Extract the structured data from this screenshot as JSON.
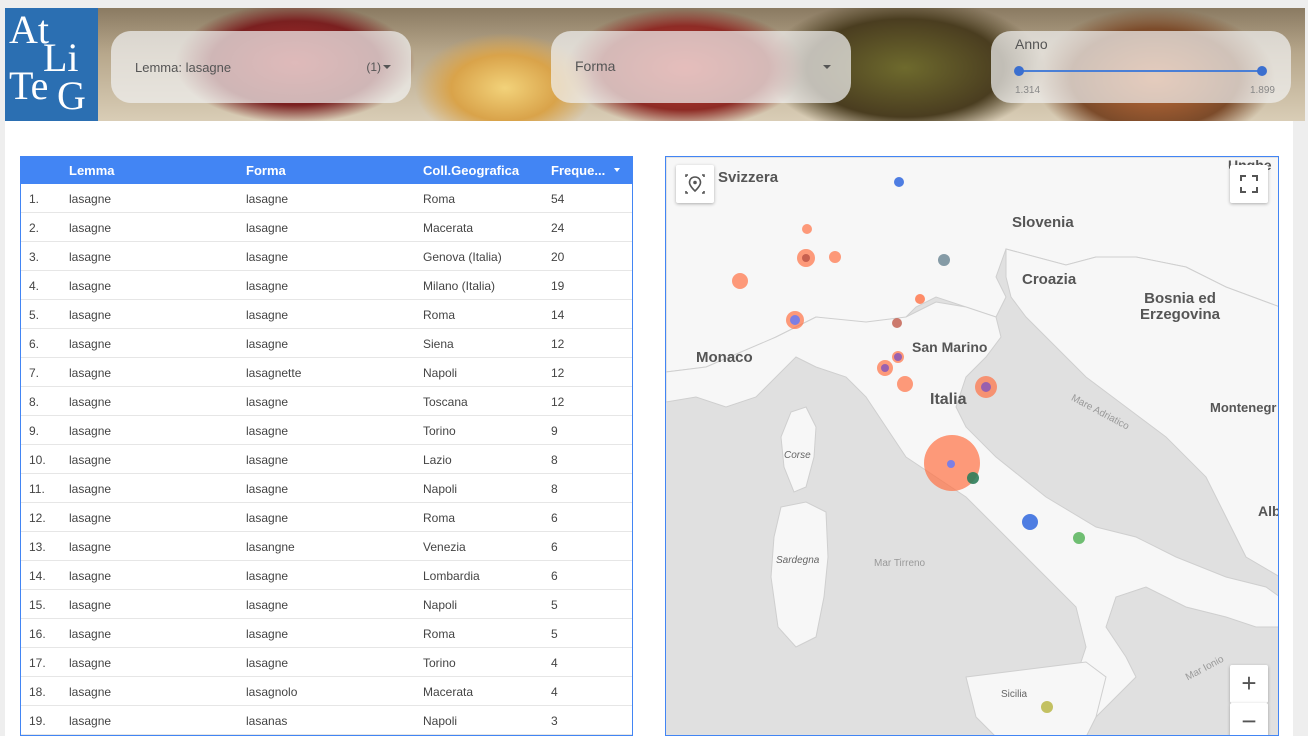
{
  "header": {
    "logo_letters": [
      "At",
      "Li",
      "Te",
      "G"
    ],
    "lemma": {
      "label": "Lemma: lasagne",
      "count": "(1)"
    },
    "forma": {
      "label": "Forma"
    },
    "anno": {
      "title": "Anno",
      "min": "1.314",
      "max": "1.899"
    }
  },
  "table": {
    "columns": [
      "Lemma",
      "Forma",
      "Coll.Geografica",
      "Freque..."
    ],
    "rows": [
      [
        "1.",
        "lasagne",
        "lasagne",
        "Roma",
        "54"
      ],
      [
        "2.",
        "lasagne",
        "lasagne",
        "Macerata",
        "24"
      ],
      [
        "3.",
        "lasagne",
        "lasagne",
        "Genova (Italia)",
        "20"
      ],
      [
        "4.",
        "lasagne",
        "lasagne",
        "Milano (Italia)",
        "19"
      ],
      [
        "5.",
        "lasagne",
        "lasagne",
        "Roma",
        "14"
      ],
      [
        "6.",
        "lasagne",
        "lasagne",
        "Siena",
        "12"
      ],
      [
        "7.",
        "lasagne",
        "lasagnette",
        "Napoli",
        "12"
      ],
      [
        "8.",
        "lasagne",
        "lasagne",
        "Toscana",
        "12"
      ],
      [
        "9.",
        "lasagne",
        "lasagne",
        "Torino",
        "9"
      ],
      [
        "10.",
        "lasagne",
        "lasagne",
        "Lazio",
        "8"
      ],
      [
        "11.",
        "lasagne",
        "lasagne",
        "Napoli",
        "8"
      ],
      [
        "12.",
        "lasagne",
        "lasagne",
        "Roma",
        "6"
      ],
      [
        "13.",
        "lasagne",
        "lasangne",
        "Venezia",
        "6"
      ],
      [
        "14.",
        "lasagne",
        "lasagne",
        "Lombardia",
        "6"
      ],
      [
        "15.",
        "lasagne",
        "lasagne",
        "Napoli",
        "5"
      ],
      [
        "16.",
        "lasagne",
        "lasagne",
        "Roma",
        "5"
      ],
      [
        "17.",
        "lasagne",
        "lasagne",
        "Torino",
        "4"
      ],
      [
        "18.",
        "lasagne",
        "lasagnolo",
        "Macerata",
        "4"
      ],
      [
        "19.",
        "lasagne",
        "lasanas",
        "Napoli",
        "3"
      ]
    ]
  },
  "map": {
    "labels": {
      "svizzera": "Svizzera",
      "slovenia": "Slovenia",
      "croazia": "Croazia",
      "bosnia": "Bosnia ed\nErzegovina",
      "monaco": "Monaco",
      "sanmarino": "San Marino",
      "italia": "Italia",
      "montenegro": "Montenegr",
      "ungheria": "Unghe",
      "albania": "Alb",
      "corse": "Corse",
      "sardegna": "Sardegna",
      "tirreno": "Mar Tirreno",
      "adriatico": "Mare Adriatico",
      "ionio": "Mar Ionio",
      "sicilia": "Sicilia"
    },
    "zoom_in": "+",
    "zoom_out": "−",
    "colors": {
      "accent": "#4285f4",
      "bubble": "#ff7043",
      "sea": "#e0e0e0",
      "land": "#f7f7f7"
    }
  }
}
